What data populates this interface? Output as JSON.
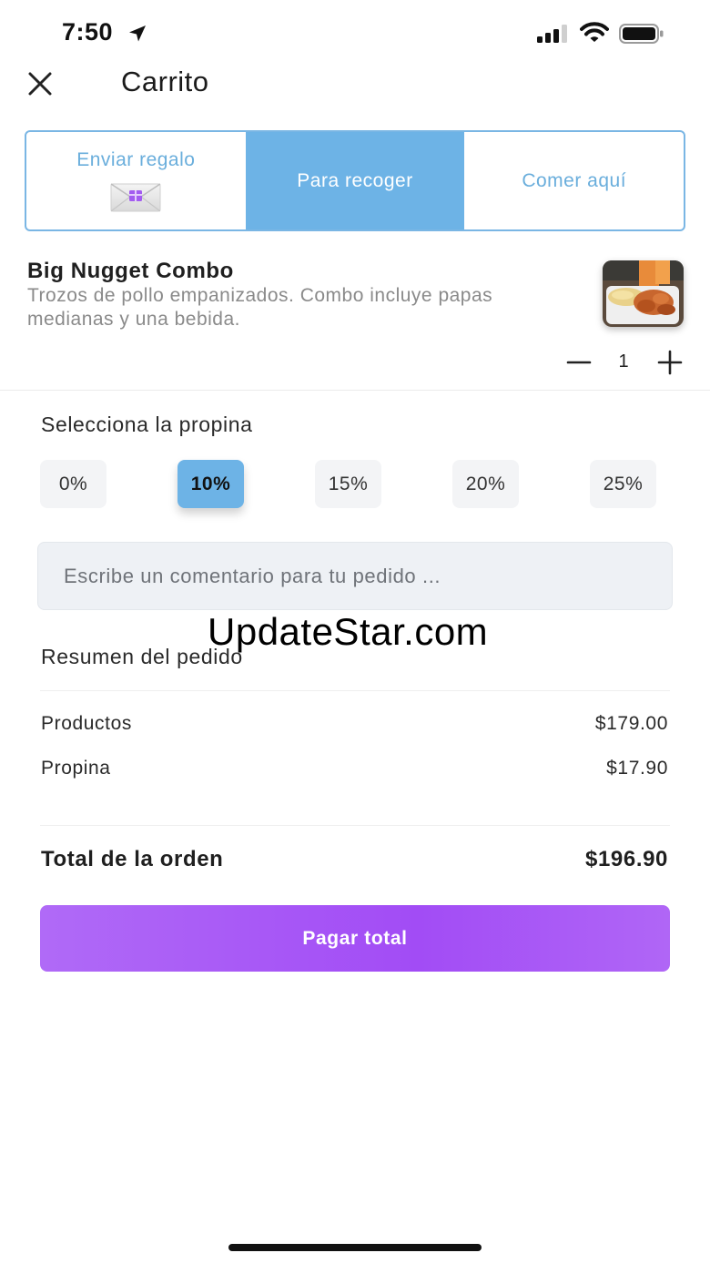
{
  "status_bar": {
    "time": "7:50",
    "icons": [
      "location-arrow-icon",
      "signal-icon",
      "wifi-icon",
      "battery-icon"
    ]
  },
  "header": {
    "title": "Carrito",
    "close_icon": "close-icon"
  },
  "order_type": {
    "options": [
      {
        "label": "Enviar regalo",
        "icon": "gift-envelope-icon",
        "selected": false
      },
      {
        "label": "Para recoger",
        "selected": true
      },
      {
        "label": "Comer aquí",
        "selected": false
      }
    ]
  },
  "product": {
    "name": "Big Nugget Combo",
    "description": "Trozos de pollo empanizados. Combo incluye papas medianas y una bebida.",
    "quantity": "1",
    "image": "nuggets-combo-photo"
  },
  "tip": {
    "heading": "Selecciona la propina",
    "options": [
      "0%",
      "10%",
      "15%",
      "20%",
      "25%"
    ],
    "selected": "10%"
  },
  "comment": {
    "placeholder": "Escribe un comentario para tu pedido ...",
    "value": ""
  },
  "watermark": "UpdateStar.com",
  "summary": {
    "heading": "Resumen del pedido",
    "rows": [
      {
        "label": "Productos",
        "value": "$179.00"
      },
      {
        "label": "Propina",
        "value": "$17.90"
      }
    ],
    "total_label": "Total de la orden",
    "total_value": "$196.90"
  },
  "pay_button": {
    "label": "Pagar total"
  },
  "colors": {
    "accent_blue": "#6db3e6",
    "pay_purple": "#a24cf5",
    "muted_text": "#8a8a8a"
  }
}
